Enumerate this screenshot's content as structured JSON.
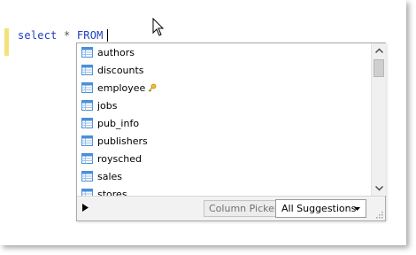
{
  "editor": {
    "keyword_select": "select",
    "star": "*",
    "keyword_from": "FROM"
  },
  "suggestions": {
    "items": [
      {
        "label": "authors",
        "icon": "table-icon"
      },
      {
        "label": "discounts",
        "icon": "table-icon"
      },
      {
        "label": "employee",
        "icon": "table-icon",
        "badge_icon": "key-icon"
      },
      {
        "label": "jobs",
        "icon": "table-icon"
      },
      {
        "label": "pub_info",
        "icon": "table-icon"
      },
      {
        "label": "publishers",
        "icon": "table-icon"
      },
      {
        "label": "roysched",
        "icon": "table-icon"
      },
      {
        "label": "sales",
        "icon": "table-icon"
      },
      {
        "label": "stores",
        "icon": "table-icon"
      }
    ]
  },
  "footer": {
    "column_picker_label": "Column Picker",
    "filter_label": "All Suggestions"
  },
  "colors": {
    "keyword": "#1f3fbf",
    "gutter_highlight": "#f3e27a",
    "table_icon": "#4a8fd8"
  }
}
